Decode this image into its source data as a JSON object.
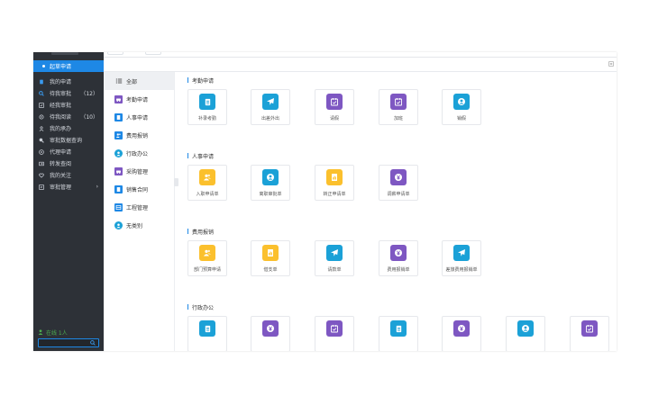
{
  "sidebar": {
    "active_item": "起草申请",
    "items": [
      {
        "label": "我的申请",
        "icon": "document-icon",
        "count": ""
      },
      {
        "label": "待我审批",
        "icon": "search-icon",
        "count": "（12）"
      },
      {
        "label": "经我审批",
        "icon": "approved-icon",
        "count": ""
      },
      {
        "label": "待我阅读",
        "icon": "eye-icon",
        "count": "（10）"
      },
      {
        "label": "我的承办",
        "icon": "user-icon",
        "count": ""
      },
      {
        "label": "审批数据查询",
        "icon": "magnifier-icon",
        "count": ""
      },
      {
        "label": "代理申请",
        "icon": "proxy-icon",
        "count": ""
      },
      {
        "label": "转发查阅",
        "icon": "forward-icon",
        "count": ""
      },
      {
        "label": "我的关注",
        "icon": "heart-icon",
        "count": ""
      },
      {
        "label": "审批管理",
        "icon": "manage-icon",
        "count": "›"
      }
    ],
    "online_label": "在线 1人",
    "search_placeholder": ""
  },
  "categories": [
    {
      "label": "全部",
      "icon": "list-icon",
      "color": "list",
      "selected": true
    },
    {
      "label": "考勤申请",
      "icon": "car-icon",
      "color": "purple",
      "selected": false
    },
    {
      "label": "人事申请",
      "icon": "doc-icon",
      "color": "blue",
      "selected": false
    },
    {
      "label": "费用报销",
      "icon": "people-icon",
      "color": "blue",
      "selected": false
    },
    {
      "label": "行政办公",
      "icon": "person-icon",
      "color": "teal",
      "selected": false
    },
    {
      "label": "采购管理",
      "icon": "car-icon",
      "color": "purple",
      "selected": false
    },
    {
      "label": "销售合同",
      "icon": "doc-icon",
      "color": "blue",
      "selected": false
    },
    {
      "label": "工程管理",
      "icon": "table-icon",
      "color": "blue",
      "selected": false
    },
    {
      "label": "无类别",
      "icon": "person-icon",
      "color": "teal",
      "selected": false
    }
  ],
  "sections": [
    {
      "title": "考勤申请",
      "apps": [
        {
          "name": "补录考勤",
          "icon": "document-icon",
          "color": "cyan"
        },
        {
          "name": "出差外出",
          "icon": "plane-icon",
          "color": "cyan"
        },
        {
          "name": "请假",
          "icon": "calendar-icon",
          "color": "purple"
        },
        {
          "name": "加班",
          "icon": "calendar-icon",
          "color": "purple"
        },
        {
          "name": "销假",
          "icon": "person-icon",
          "color": "cyan"
        }
      ]
    },
    {
      "title": "人事申请",
      "apps": [
        {
          "name": "入职申请单",
          "icon": "people-icon",
          "color": "yellow"
        },
        {
          "name": "离职审批单",
          "icon": "person-icon",
          "color": "cyan"
        },
        {
          "name": "转正申请单",
          "icon": "report-icon",
          "color": "yellow"
        },
        {
          "name": "调薪申请单",
          "icon": "yen-icon",
          "color": "purple"
        }
      ]
    },
    {
      "title": "费用报销",
      "apps": [
        {
          "name": "部门预算申请",
          "icon": "people-icon",
          "color": "yellow"
        },
        {
          "name": "借支单",
          "icon": "report-icon",
          "color": "yellow"
        },
        {
          "name": "请款单",
          "icon": "plane-icon",
          "color": "cyan"
        },
        {
          "name": "费用报销单",
          "icon": "yen-icon",
          "color": "purple"
        },
        {
          "name": "差旅费用报销单",
          "icon": "plane-icon",
          "color": "cyan"
        }
      ]
    },
    {
      "title": "行政办公",
      "apps": [
        {
          "name": "",
          "icon": "document-icon",
          "color": "cyan"
        },
        {
          "name": "",
          "icon": "yen-icon",
          "color": "purple"
        },
        {
          "name": "",
          "icon": "calendar-icon",
          "color": "purple"
        },
        {
          "name": "",
          "icon": "document-icon",
          "color": "cyan"
        },
        {
          "name": "",
          "icon": "yen-icon",
          "color": "purple"
        },
        {
          "name": "",
          "icon": "person-icon",
          "color": "cyan"
        },
        {
          "name": "",
          "icon": "calendar-icon",
          "color": "purple"
        }
      ]
    }
  ],
  "colors": {
    "sidebar_bg": "#2d3137",
    "accent": "#1e88e5",
    "cyan": "#1ba1d7",
    "purple": "#7e57c2",
    "yellow": "#fbc02d",
    "online": "#4caf50"
  }
}
